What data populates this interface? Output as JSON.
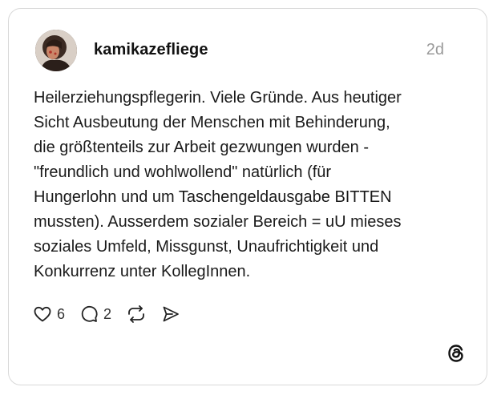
{
  "post": {
    "username": "kamikazefliege",
    "timestamp": "2d",
    "text": "Heilerziehungspflegerin. Viele Gründe. Aus heutiger\nSicht Ausbeutung der Menschen mit Behinderung,\ndie größtenteils zur Arbeit gezwungen wurden -\n\"freundlich und wohlwollend\" natürlich (für\nHungerlohn und um Taschengeldausgabe BITTEN\nmussten). Ausserdem sozialer Bereich = uU mieses\nsoziales Umfeld, Missgunst, Unaufrichtigkeit und\nKonkurrenz unter KollegInnen."
  },
  "actions": {
    "like_icon": "heart-icon",
    "like_count": "6",
    "reply_icon": "comment-icon",
    "reply_count": "2",
    "repost_icon": "repost-icon",
    "share_icon": "send-icon"
  },
  "branding": {
    "logo_icon": "threads-logo-icon"
  }
}
